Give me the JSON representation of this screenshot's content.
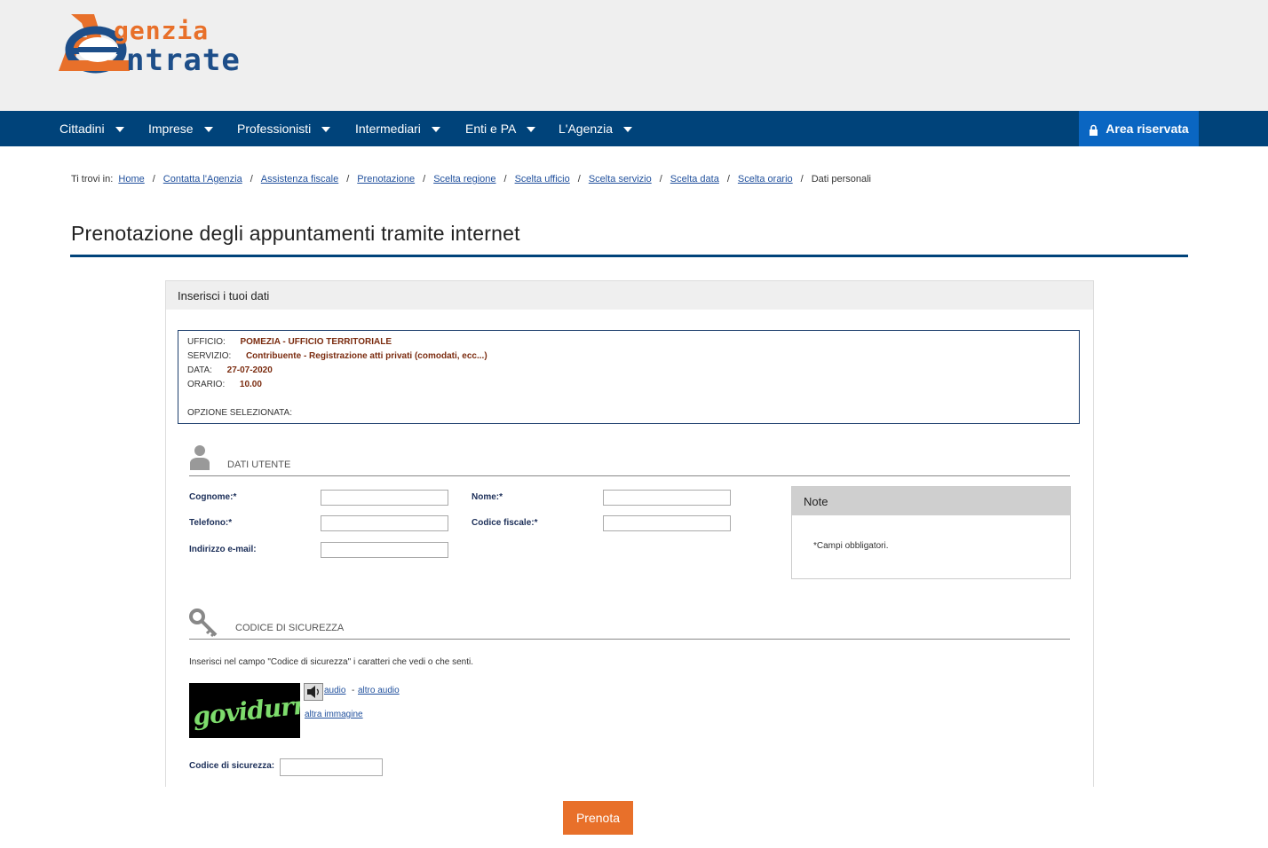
{
  "logo": {
    "line1": "genzia",
    "line2": "ntrate",
    "letter_a": "A",
    "letter_e": "E"
  },
  "nav": {
    "items": [
      "Cittadini",
      "Imprese",
      "Professionisti",
      "Intermediari",
      "Enti e PA",
      "L'Agenzia"
    ],
    "area_riservata": "Area riservata"
  },
  "breadcrumb": {
    "prefix": "Ti trovi in:",
    "links": [
      "Home",
      "Contatta l'Agenzia",
      "Assistenza fiscale",
      "Prenotazione",
      "Scelta regione",
      "Scelta ufficio",
      "Scelta servizio",
      "Scelta data",
      "Scelta orario"
    ],
    "current": "Dati personali",
    "separator": "/"
  },
  "page_title": "Prenotazione degli appuntamenti tramite internet",
  "panel": {
    "heading": "Inserisci i tuoi dati",
    "summary": {
      "ufficio_label": "UFFICIO:",
      "ufficio_value": "POMEZIA - UFFICIO TERRITORIALE",
      "servizio_label": "SERVIZIO:",
      "servizio_value": "Contribuente - Registrazione atti privati (comodati, ecc...)",
      "data_label": "DATA:",
      "data_value": "27-07-2020",
      "orario_label": "ORARIO:",
      "orario_value": "10.00",
      "opzione_label": "OPZIONE SELEZIONATA:"
    },
    "dati_utente": {
      "title": "DATI UTENTE",
      "cognome_label": "Cognome:*",
      "cognome_value": "",
      "nome_label": "Nome:*",
      "nome_value": "",
      "telefono_label": "Telefono:*",
      "telefono_value": "",
      "codice_fiscale_label": "Codice fiscale:*",
      "codice_fiscale_value": "",
      "email_label": "Indirizzo e-mail:",
      "email_value": ""
    },
    "note": {
      "title": "Note",
      "text": "*Campi obbligatori."
    },
    "sicurezza": {
      "title": "CODICE DI SICUREZZA",
      "instructions": "Inserisci nel campo \"Codice di sicurezza\" i caratteri che vedi o che senti.",
      "captcha_text": "govidurro",
      "audio_link": "audio",
      "dash": "-",
      "altro_audio_link": "altro audio",
      "altra_immagine_link": "altra immagine",
      "codice_label": "Codice di sicurezza:",
      "codice_value": ""
    }
  },
  "submit_label": "Prenota",
  "colors": {
    "nav_bg": "#00437a",
    "area_bg": "#0a66c2",
    "accent_orange": "#e8702a",
    "header_bg": "#efefef"
  }
}
